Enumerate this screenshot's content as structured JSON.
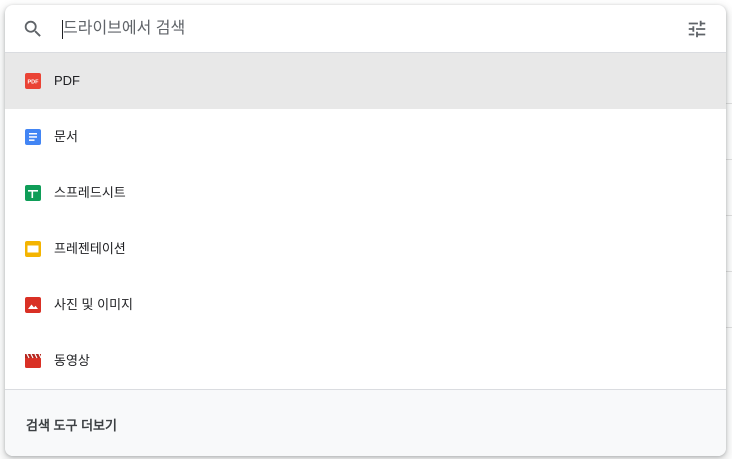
{
  "search": {
    "placeholder": "드라이브에서 검색"
  },
  "file_types": [
    {
      "label": "PDF",
      "icon": "pdf-icon",
      "color": "#ea4335"
    },
    {
      "label": "문서",
      "icon": "docs-icon",
      "color": "#4285f4"
    },
    {
      "label": "스프레드시트",
      "icon": "sheets-icon",
      "color": "#0f9d58"
    },
    {
      "label": "프레젠테이션",
      "icon": "slides-icon",
      "color": "#f4b400"
    },
    {
      "label": "사진 및 이미지",
      "icon": "image-icon",
      "color": "#ea4335"
    },
    {
      "label": "동영상",
      "icon": "video-icon",
      "color": "#ea4335"
    }
  ],
  "footer": {
    "label": "검색 도구 더보기"
  },
  "colors": {
    "active_row": "#e8e8e8",
    "divider": "#dadce0",
    "footer_bg": "#f8f9fa"
  }
}
